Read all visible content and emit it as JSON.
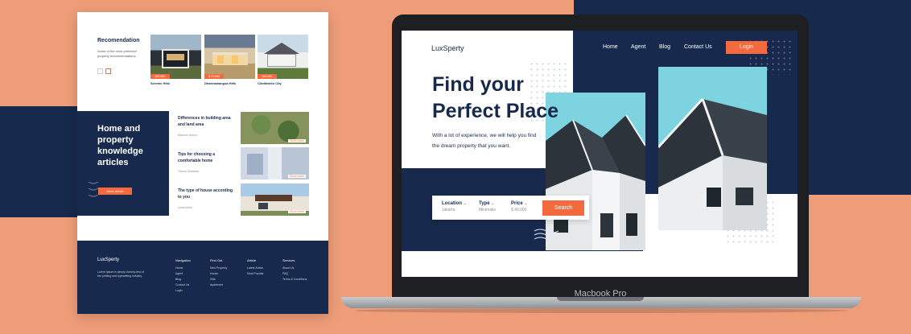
{
  "colors": {
    "background": "#ee9d78",
    "navy": "#17294d",
    "accent": "#f26a3d",
    "sky": "#7dd3e0"
  },
  "left_mockup": {
    "recommendation": {
      "title": "Recomendation",
      "description": "Some of the most preferred property recommendations",
      "cards": [
        {
          "name": "Serenic Hills",
          "price": "$50,500"
        },
        {
          "name": "Dharmawangsa Hills",
          "price": "$ 70,500"
        },
        {
          "name": "Clintfarden City",
          "price": "$40,500"
        }
      ]
    },
    "articles": {
      "heading": "Home and property knowledge articles",
      "more_button": "More Article",
      "items": [
        {
          "title": "Differences in building area and land area",
          "meta": "Baskoro Utomo",
          "link": "Show more"
        },
        {
          "title": "Tips for choosing a comfortable home",
          "meta": "Tirtana Sulaiman",
          "link": "Show more"
        },
        {
          "title": "The type of house according to you",
          "meta": "Laura Anila",
          "link": "Show more"
        }
      ]
    },
    "footer": {
      "logo": "LuxSperty",
      "description": "Lorem Ipsum is simply dummy text of the printing and typesetting industry.",
      "columns": [
        {
          "title": "Navigation",
          "links": [
            "Home",
            "Agent",
            "Blog",
            "Contact Us",
            "Login"
          ]
        },
        {
          "title": "Find Out",
          "links": [
            "New Property",
            "House",
            "Villa",
            "Apartment"
          ]
        },
        {
          "title": "Article",
          "links": [
            "Latest Article",
            "Most Popular"
          ]
        },
        {
          "title": "Services",
          "links": [
            "About Us",
            "FAQ",
            "Terms & Conditions"
          ]
        }
      ]
    }
  },
  "laptop": {
    "model_label": "Macbook Pro",
    "logo": "LuxSperty",
    "nav": [
      "Home",
      "Agent",
      "Blog",
      "Contact Us"
    ],
    "login": "Login",
    "hero": {
      "title_line1": "Find your",
      "title_line2": "Perfect Place",
      "subtitle_line1": "With a lot of experience, we will help you find",
      "subtitle_line2": "the dream property that you want."
    },
    "search": {
      "location_label": "Location",
      "location_value": "Jakarta",
      "type_label": "Type",
      "type_value": "Minimalis",
      "price_label": "Price",
      "price_value": "$ 40,000",
      "button": "Search"
    }
  }
}
